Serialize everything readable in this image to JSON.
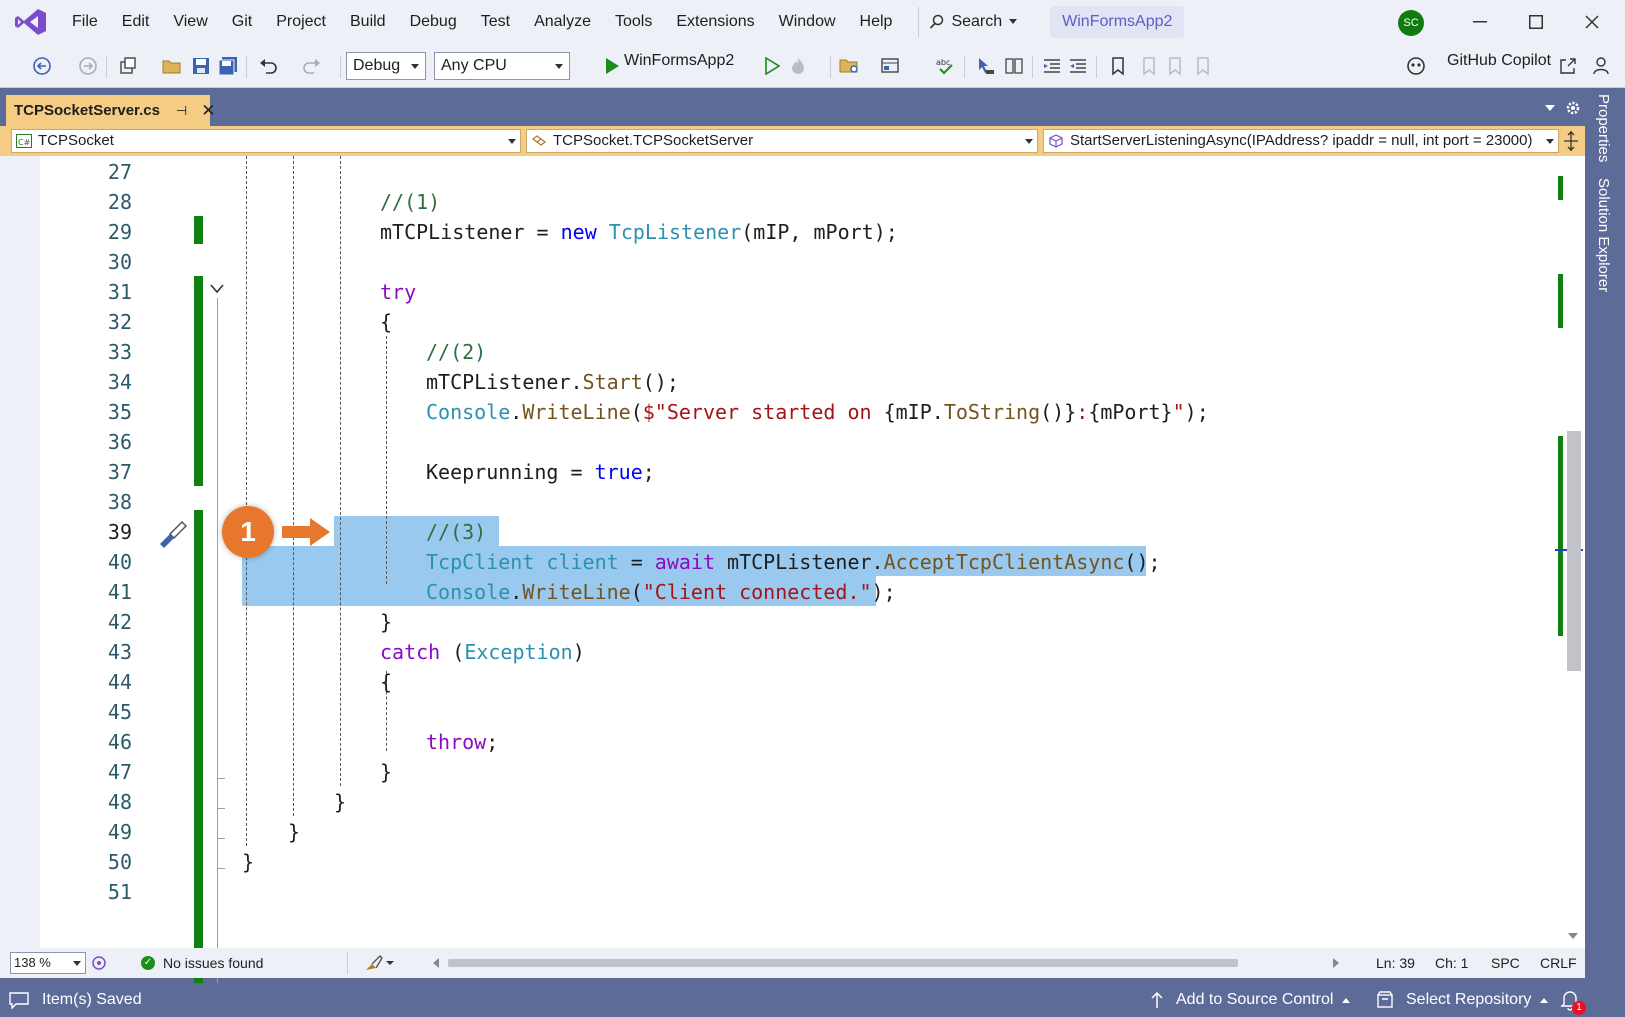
{
  "menubar": {
    "items": [
      "File",
      "Edit",
      "View",
      "Git",
      "Project",
      "Build",
      "Debug",
      "Test",
      "Analyze",
      "Tools",
      "Extensions",
      "Window",
      "Help"
    ],
    "search_label": "Search",
    "project_name": "WinFormsApp2",
    "avatar_initials": "SC"
  },
  "toolbar": {
    "configuration": "Debug",
    "platform": "Any CPU",
    "run_target": "WinFormsApp2",
    "copilot_label": "GitHub Copilot"
  },
  "document": {
    "tab_title": "TCPSocketServer.cs",
    "nav_project": "TCPSocket",
    "nav_class": "TCPSocket.TCPSocketServer",
    "nav_member": "StartServerListeningAsync(IPAddress? ipaddr = null, int port = 23000)"
  },
  "side_panel": {
    "tabs": [
      "Properties",
      "Solution Explorer"
    ]
  },
  "editor": {
    "current_line": 39,
    "annotation_number": "1",
    "lines": [
      {
        "n": "27",
        "segs": []
      },
      {
        "n": "28",
        "segs": [
          {
            "t": "//(1)",
            "c": "cm"
          }
        ]
      },
      {
        "n": "29",
        "segs": [
          {
            "t": "mTCPListener = ",
            "c": ""
          },
          {
            "t": "new",
            "c": "kw"
          },
          {
            "t": " ",
            "c": ""
          },
          {
            "t": "TcpListener",
            "c": "ty"
          },
          {
            "t": "(mIP, mPort);",
            "c": ""
          }
        ]
      },
      {
        "n": "30",
        "segs": []
      },
      {
        "n": "31",
        "segs": [
          {
            "t": "try",
            "c": "kw2"
          }
        ]
      },
      {
        "n": "32",
        "segs": [
          {
            "t": "{",
            "c": ""
          }
        ]
      },
      {
        "n": "33",
        "segs": [
          {
            "t": "//(2)",
            "c": "cm"
          }
        ]
      },
      {
        "n": "34",
        "segs": [
          {
            "t": "mTCPListener.",
            "c": ""
          },
          {
            "t": "Start",
            "c": "mt"
          },
          {
            "t": "();",
            "c": ""
          }
        ]
      },
      {
        "n": "35",
        "segs": [
          {
            "t": "Console",
            "c": "ty"
          },
          {
            "t": ".",
            "c": ""
          },
          {
            "t": "WriteLine",
            "c": "mt"
          },
          {
            "t": "(",
            "c": ""
          },
          {
            "t": "$\"Server started on ",
            "c": "st"
          },
          {
            "t": "{mIP.",
            "c": ""
          },
          {
            "t": "ToString",
            "c": "mt"
          },
          {
            "t": "()}",
            "c": ""
          },
          {
            "t": ":",
            "c": "st"
          },
          {
            "t": "{mPort}",
            "c": ""
          },
          {
            "t": "\"",
            "c": "st"
          },
          {
            "t": ");",
            "c": ""
          }
        ]
      },
      {
        "n": "36",
        "segs": []
      },
      {
        "n": "37",
        "segs": [
          {
            "t": "Keeprunning = ",
            "c": ""
          },
          {
            "t": "true",
            "c": "kw"
          },
          {
            "t": ";",
            "c": ""
          }
        ]
      },
      {
        "n": "38",
        "segs": []
      },
      {
        "n": "39",
        "segs": [
          {
            "t": "//(3)",
            "c": "cm"
          }
        ]
      },
      {
        "n": "40",
        "segs": [
          {
            "t": "TcpClient",
            "c": "ty"
          },
          {
            "t": " ",
            "c": ""
          },
          {
            "t": "client",
            "c": "ty"
          },
          {
            "t": " = ",
            "c": ""
          },
          {
            "t": "await",
            "c": "kw2"
          },
          {
            "t": " mTCPListener.",
            "c": ""
          },
          {
            "t": "AcceptTcpClientAsync",
            "c": "mt"
          },
          {
            "t": "();",
            "c": ""
          }
        ]
      },
      {
        "n": "41",
        "segs": [
          {
            "t": "Console",
            "c": "ty"
          },
          {
            "t": ".",
            "c": ""
          },
          {
            "t": "WriteLine",
            "c": "mt"
          },
          {
            "t": "(",
            "c": ""
          },
          {
            "t": "\"Client connected.\"",
            "c": "st"
          },
          {
            "t": ");",
            "c": ""
          }
        ]
      },
      {
        "n": "42",
        "segs": [
          {
            "t": "}",
            "c": ""
          }
        ]
      },
      {
        "n": "43",
        "segs": [
          {
            "t": "catch",
            "c": "kw2"
          },
          {
            "t": " (",
            "c": ""
          },
          {
            "t": "Exception",
            "c": "ty"
          },
          {
            "t": ")",
            "c": ""
          }
        ]
      },
      {
        "n": "44",
        "segs": [
          {
            "t": "{",
            "c": ""
          }
        ]
      },
      {
        "n": "45",
        "segs": []
      },
      {
        "n": "46",
        "segs": [
          {
            "t": "throw",
            "c": "kw2"
          },
          {
            "t": ";",
            "c": ""
          }
        ]
      },
      {
        "n": "47",
        "segs": [
          {
            "t": "}",
            "c": ""
          }
        ]
      },
      {
        "n": "48",
        "segs": [
          {
            "t": "}",
            "c": ""
          }
        ]
      },
      {
        "n": "49",
        "segs": [
          {
            "t": "}",
            "c": ""
          }
        ]
      },
      {
        "n": "50",
        "segs": [
          {
            "t": "}",
            "c": ""
          }
        ]
      },
      {
        "n": "51",
        "segs": []
      }
    ]
  },
  "editor_status": {
    "zoom": "138 %",
    "issues": "No issues found",
    "line": "Ln: 39",
    "char": "Ch: 1",
    "whitespace": "SPC",
    "line_ending": "CRLF"
  },
  "statusbar": {
    "message": "Item(s) Saved",
    "source_control": "Add to Source Control",
    "repository": "Select Repository",
    "notification_count": "1"
  },
  "colors": {
    "accent": "#5d6b99",
    "tab_active": "#f5cc84",
    "selection": "#99c9ef",
    "change_bar": "#108010",
    "annotation": "#e8772e"
  }
}
